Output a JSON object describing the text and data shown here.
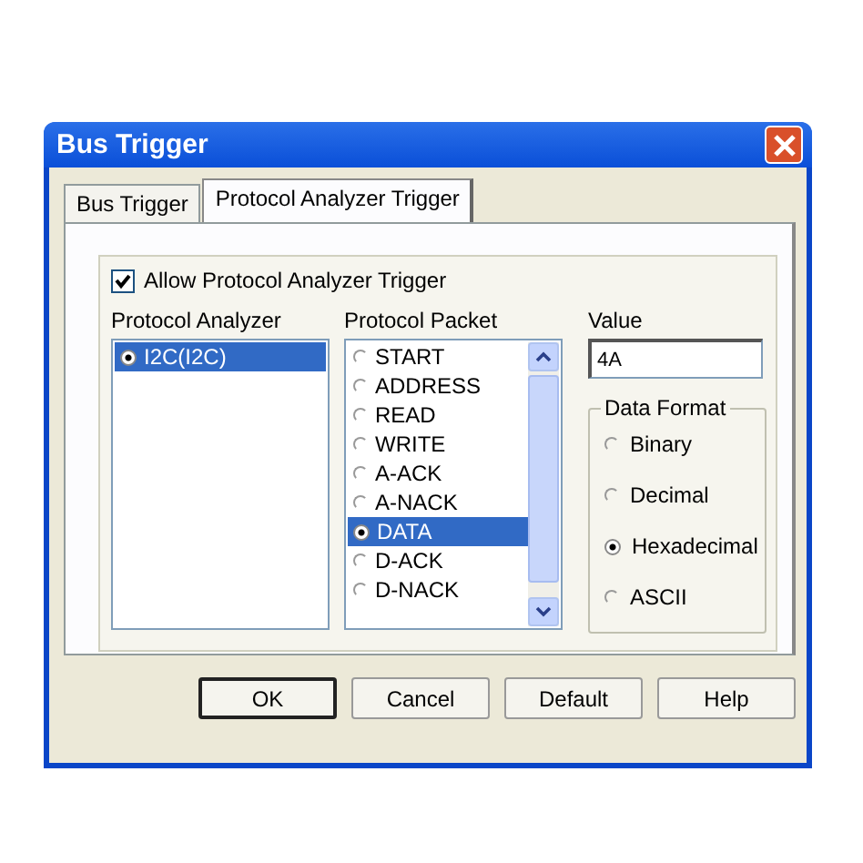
{
  "window": {
    "title": "Bus Trigger"
  },
  "tabs": [
    {
      "label": "Bus Trigger",
      "selected": false
    },
    {
      "label": "Protocol Analyzer Trigger",
      "selected": true
    }
  ],
  "allow_trigger": {
    "label": "Allow Protocol Analyzer Trigger",
    "checked": true
  },
  "protocol_analyzer": {
    "label": "Protocol Analyzer",
    "items": [
      {
        "label": "I2C(I2C)",
        "selected": true
      }
    ]
  },
  "protocol_packet": {
    "label": "Protocol Packet",
    "items": [
      {
        "label": "START",
        "selected": false
      },
      {
        "label": "ADDRESS",
        "selected": false
      },
      {
        "label": "READ",
        "selected": false
      },
      {
        "label": "WRITE",
        "selected": false
      },
      {
        "label": "A-ACK",
        "selected": false
      },
      {
        "label": "A-NACK",
        "selected": false
      },
      {
        "label": "DATA",
        "selected": true
      },
      {
        "label": "D-ACK",
        "selected": false
      },
      {
        "label": "D-NACK",
        "selected": false
      }
    ]
  },
  "value": {
    "label": "Value",
    "value": "4A"
  },
  "data_format": {
    "label": "Data Format",
    "options": [
      {
        "label": "Binary",
        "selected": false
      },
      {
        "label": "Decimal",
        "selected": false
      },
      {
        "label": "Hexadecimal",
        "selected": true
      },
      {
        "label": "ASCII",
        "selected": false
      }
    ]
  },
  "buttons": [
    {
      "label": "OK",
      "default": true
    },
    {
      "label": "Cancel",
      "default": false
    },
    {
      "label": "Default",
      "default": false
    },
    {
      "label": "Help",
      "default": false
    }
  ]
}
